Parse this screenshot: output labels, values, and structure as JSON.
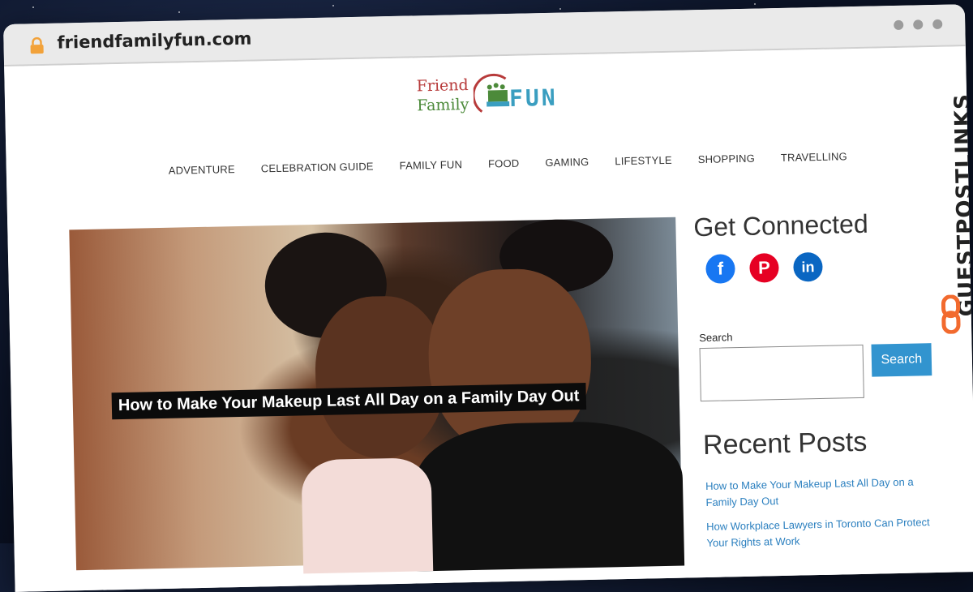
{
  "browser": {
    "url": "friendfamilyfun.com",
    "lock_icon": "lock-icon"
  },
  "logo": {
    "word1": "Friend",
    "word2": "Family",
    "word3": "FUN"
  },
  "nav": {
    "items": [
      "ADVENTURE",
      "CELEBRATION GUIDE",
      "FAMILY FUN",
      "FOOD",
      "GAMING",
      "LIFESTYLE",
      "SHOPPING",
      "TRAVELLING"
    ]
  },
  "hero": {
    "caption": "How to Make Your Makeup Last All Day on a Family Day Out"
  },
  "sidebar": {
    "get_connected": "Get Connected",
    "social": [
      "facebook-icon",
      "pinterest-icon",
      "linkedin-icon"
    ],
    "search_label": "Search",
    "search_button": "Search",
    "recent_title": "Recent Posts",
    "recent_posts": [
      "How to Make Your Makeup Last All Day on a Family Day Out",
      "How Workplace Lawyers in Toronto Can Protect Your Rights at Work"
    ]
  },
  "badge": {
    "text": "GUESTPOSTLINKS"
  },
  "colors": {
    "accent": "#3294cf",
    "link": "#2a7fbf",
    "badge_orange": "#f26a2e"
  }
}
